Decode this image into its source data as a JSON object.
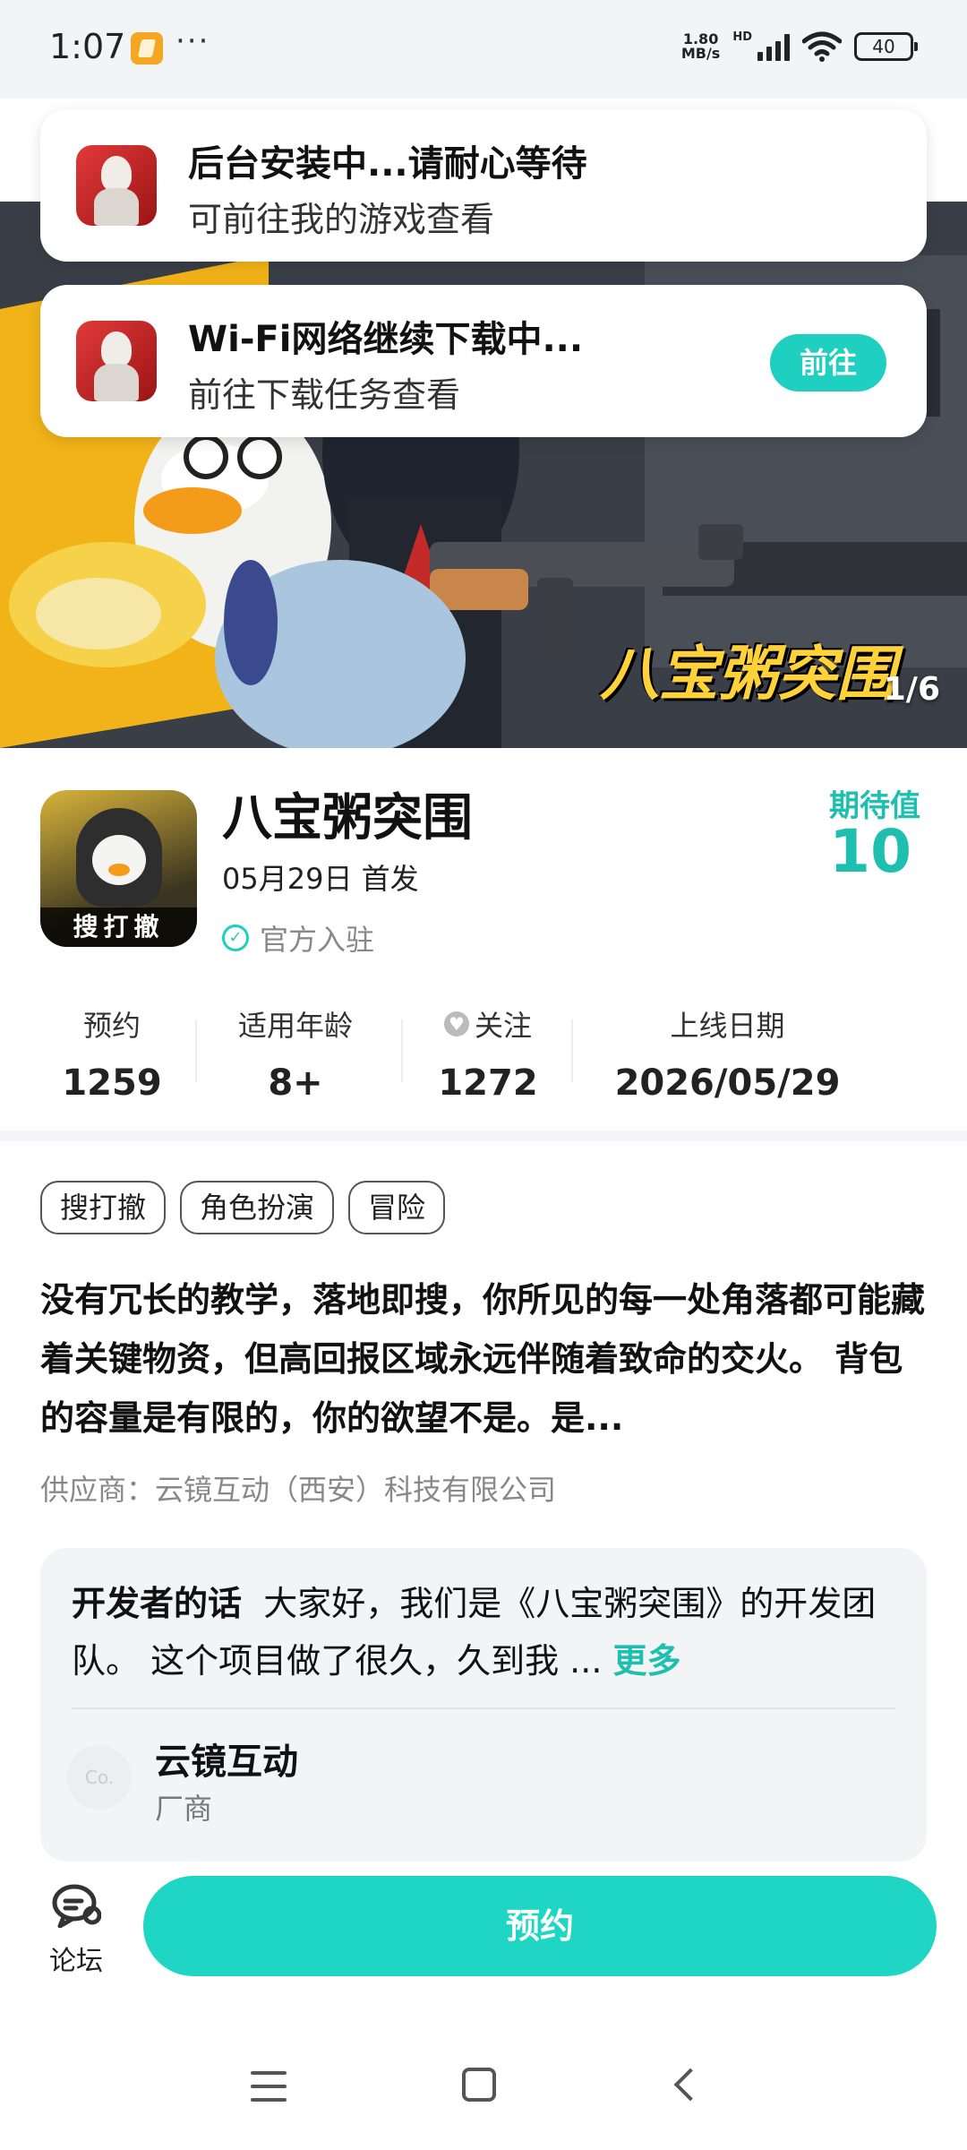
{
  "status_bar": {
    "time": "1:07",
    "more": "···",
    "net_speed": "1.80",
    "net_unit": "MB/s",
    "hd": "HD",
    "battery": "40"
  },
  "banner": {
    "title": "八宝粥突围",
    "counter": "1/6"
  },
  "toast_install": {
    "title": "后台安装中...请耐心等待",
    "subtitle": "可前往我的游戏查看"
  },
  "toast_download": {
    "title": "Wi-Fi网络继续下载中...",
    "subtitle": "前往下载任务查看",
    "button": "前往"
  },
  "game": {
    "icon_tag": "搜打撤",
    "title": "八宝粥突围",
    "release": "05月29日 首发",
    "official": "官方入驻",
    "expect_label": "期待值",
    "expect_value": "10"
  },
  "stats": [
    {
      "label": "预约",
      "value": "1259"
    },
    {
      "label": "适用年龄",
      "value": "8+"
    },
    {
      "label": "关注",
      "value": "1272"
    },
    {
      "label": "上线日期",
      "value": "2026/05/29"
    }
  ],
  "tags": [
    "搜打撤",
    "角色扮演",
    "冒险"
  ],
  "description": "没有冗长的教学，落地即搜，你所见的每一处角落都可能藏着关键物资，但高回报区域永远伴随着致命的交火。 背包的容量是有限的，你的欲望不是。是...",
  "supplier": "供应商：云镜互动（西安）科技有限公司",
  "developer": {
    "label": "开发者的话",
    "text": "大家好，我们是《八宝粥突围》的开发团队。 这个项目做了很久，久到我 ...",
    "more": "更多",
    "avatar_text": "Co.",
    "name": "云镜互动",
    "role": "厂商"
  },
  "bottom": {
    "forum": "论坛",
    "reserve": "预约"
  },
  "colors": {
    "accent": "#1fcfbf"
  }
}
